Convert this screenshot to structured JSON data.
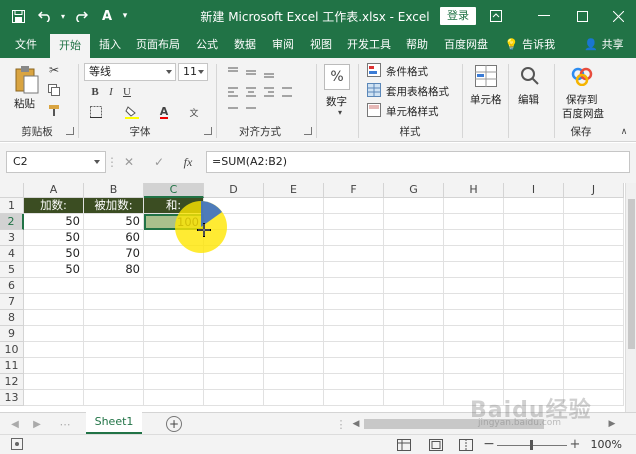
{
  "window": {
    "title": "新建 Microsoft Excel 工作表.xlsx  -  Excel",
    "login_label": "登录"
  },
  "tabs": [
    "文件",
    "开始",
    "插入",
    "页面布局",
    "公式",
    "数据",
    "审阅",
    "视图",
    "开发工具",
    "帮助",
    "百度网盘",
    "告诉我",
    "共享"
  ],
  "ribbon": {
    "paste_label": "粘贴",
    "clipboard_label": "剪贴板",
    "font_name": "等线",
    "font_size": "11",
    "font_label": "字体",
    "align_label": "对齐方式",
    "number_btn": "数字",
    "cond_format": "条件格式",
    "table_format": "套用表格格式",
    "cell_style": "单元格样式",
    "style_label": "样式",
    "cells_btn": "单元格",
    "edit_btn": "编辑",
    "save_baidu_line1": "保存到",
    "save_baidu_line2": "百度网盘",
    "save_label": "保存"
  },
  "formula_bar": {
    "name_box": "C2",
    "formula": "=SUM(A2:B2)"
  },
  "grid": {
    "columns": [
      "A",
      "B",
      "C",
      "D",
      "E",
      "F",
      "G",
      "H",
      "I",
      "J"
    ],
    "rows": [
      "1",
      "2",
      "3",
      "4",
      "5",
      "6",
      "7",
      "8",
      "9",
      "10",
      "11",
      "12",
      "13"
    ],
    "cells": {
      "A1": "加数:",
      "B1": "被加数:",
      "C1": "和:",
      "A2": "50",
      "B2": "50",
      "C2": "100",
      "A3": "50",
      "B3": "60",
      "A4": "50",
      "B4": "70",
      "A5": "50",
      "B5": "80"
    }
  },
  "sheets": [
    "Sheet1"
  ],
  "status": {
    "zoom": "100%"
  },
  "watermark": {
    "main": "Baidu经验",
    "sub": "jingyan.baidu.com"
  },
  "colors": {
    "excel_green": "#217346",
    "header_fill": "#3b4d22",
    "selected_fill": "#a9c08c",
    "cursor_highlight": "#ffe600"
  }
}
